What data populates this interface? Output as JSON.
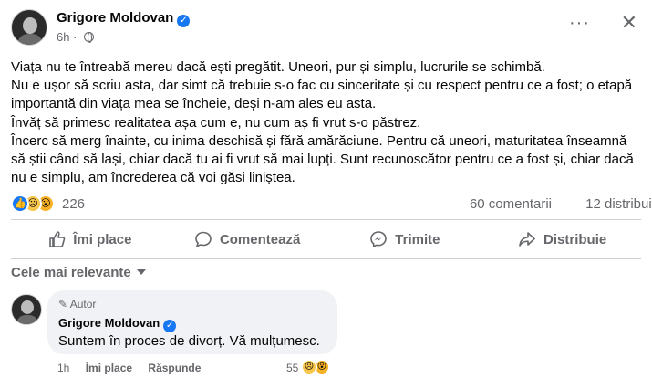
{
  "post": {
    "author": "Grigore Moldovan",
    "time": "6h",
    "paragraph_lines": [
      "Viața nu te întreabă mereu dacă ești pregătit. Uneori, pur și simplu, lucrurile se schimbă.",
      "Nu e ușor să scriu asta, dar simt că trebuie s-o fac cu sinceritate și cu respect pentru ce a fost; o etapă",
      "importantă din viața mea se încheie, deși n-am ales eu asta.",
      "Învăț să primesc realitatea așa cum e, nu cum aș fi vrut s-o păstrez.",
      "Încerc să merg înainte, cu inima deschisă și fără amărăciune. Pentru că uneori, maturitatea înseamnă",
      "să știi când să lași, chiar dacă tu ai fi vrut să mai lupți. Sunt recunoscător pentru ce a fost și, chiar dacă",
      "nu e simplu, am încrederea că voi găsi liniștea."
    ],
    "reaction_count": "226",
    "comments": "60 comentarii",
    "shares": "12 distribuiri",
    "reaction_icons": [
      "like-icon",
      "sad-icon",
      "wow-icon"
    ]
  },
  "actions": {
    "like": "Îmi place",
    "comment": "Comentează",
    "send": "Trimite",
    "share": "Distribuie"
  },
  "sort_label": "Cele mai relevante",
  "comment": {
    "badge": "Autor",
    "author": "Grigore Moldovan",
    "text": "Suntem în proces de divorț. Vă mulțumesc.",
    "time": "1h",
    "like": "Îmi place",
    "reply": "Răspunde",
    "reaction_count": "55"
  },
  "colors": {
    "accent": "#1877f2",
    "secondary_text": "#65676b",
    "bubble": "#f0f2f5"
  }
}
